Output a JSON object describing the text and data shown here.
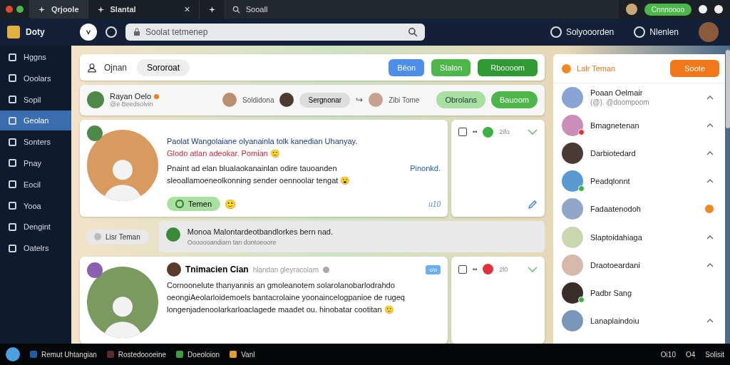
{
  "browser": {
    "tabs": [
      {
        "label": "Qrjoole",
        "selected": true
      },
      {
        "label": "Slantal",
        "selected": false,
        "close": "×"
      },
      {
        "selected": false
      }
    ],
    "address": "Sooall",
    "profile_button": "Cnnnoooo"
  },
  "header": {
    "brand": "Doty",
    "search": {
      "placeholder": "Soolat tetmenep"
    },
    "links": [
      "Solyooorden",
      "Nlenlen"
    ]
  },
  "sidebar": {
    "items": [
      {
        "label": "Hggns",
        "selected": false
      },
      {
        "label": "Ooolars",
        "selected": false
      },
      {
        "label": "Sopil",
        "selected": false
      },
      {
        "label": "Geolan",
        "selected": true
      },
      {
        "label": "Sonters",
        "selected": false
      },
      {
        "label": "Pnay",
        "selected": false
      },
      {
        "label": "Eocil",
        "selected": false
      },
      {
        "label": "Yooa",
        "selected": false
      },
      {
        "label": "Dengint",
        "selected": false
      },
      {
        "label": "Oatelrs",
        "selected": false
      }
    ]
  },
  "toolbar": {
    "title": "Ojnan",
    "filter": "Sororoat",
    "buttons": [
      {
        "label": "Bëon",
        "kind": "blue"
      },
      {
        "label": "Stalon",
        "kind": "green"
      },
      {
        "label": "Rboooom",
        "kind": "dark"
      }
    ]
  },
  "stories": {
    "user": {
      "name": "Rayan Oelo",
      "handle": "@e Beedsolvin"
    },
    "people": [
      "Soldidona",
      "Zibi Tome"
    ],
    "chip": "Sergnonar",
    "arrow": "↪",
    "buttons": [
      {
        "label": "Obrolans",
        "kind": "light"
      },
      {
        "label": "Bauoom",
        "kind": "green"
      }
    ]
  },
  "posts": [
    {
      "lines": [
        {
          "kind": "title",
          "text": "Paolat Wangolaiane olyanainla tolk kanedian Uhanyay."
        },
        {
          "kind": "alert",
          "text": "Glodo atlan adeokar. Pomian 🙂"
        },
        {
          "kind": "body",
          "text": "Pnaint ad elan blualaokanainlan odire tauoanden sleoallamoeneolkonning sender oennoolar tengat 😮 **Pinonkd.**"
        }
      ],
      "tag": "Temen",
      "reaction": "🙂",
      "footer": "u10",
      "side": {
        "checked": false,
        "more": "••",
        "badge": "2ifo",
        "color": "#3cb043"
      }
    },
    {
      "name": "Tnimacien Cian",
      "handle": "hlandan gleyracolam",
      "label": "c/o",
      "lines": [
        {
          "kind": "body",
          "text": "Cornoonelute thanyannis an gmoleanotem solarolanobarlodrahdo oeongiAeolarloidemoels bantacrolaine yoonaincelogpanioe de rugeq longenjadenoolarkarloaclagede maadet ou. hinobatar cootitan 🙂"
        }
      ],
      "side": {
        "checked": false,
        "more": "••",
        "badge": "2l0",
        "color": "#e0323c"
      }
    }
  ],
  "comment": {
    "chip": "Lisr Teman",
    "text": "Monoa Malontardeotbandlorkes bern nad.",
    "sub": "Ooooooandiam tan dontoeoore"
  },
  "friends": {
    "title": "Lalr Teman",
    "button": "Soote",
    "items": [
      {
        "name": "Poaan Oelmair",
        "sub": "(@). @doompoom",
        "kind": "chevron"
      },
      {
        "name": "Bmagnetenan",
        "color": "#e0323c",
        "kind": "chevron"
      },
      {
        "name": "Darbiotedard",
        "kind": "chevron"
      },
      {
        "name": "Peadqlonnt",
        "color": "#3cb043",
        "kind": "chevron"
      },
      {
        "name": "Fadaatenodoh",
        "kind": "badge"
      },
      {
        "name": "Slaptoidahiaga",
        "kind": "chevron"
      },
      {
        "name": "Draotoeardani",
        "kind": "chevron"
      },
      {
        "name": "Padbr Sang",
        "color": "#3cb043",
        "kind": "plain"
      },
      {
        "name": "Lanaplaindoiu",
        "kind": "chevron"
      }
    ]
  },
  "taskbar": {
    "items": [
      "Remut Uhtangian",
      "Rostedoooeine",
      "Doeoloion",
      "Vanl"
    ],
    "tray": [
      "Oi10",
      "O4",
      "Solisit"
    ]
  }
}
